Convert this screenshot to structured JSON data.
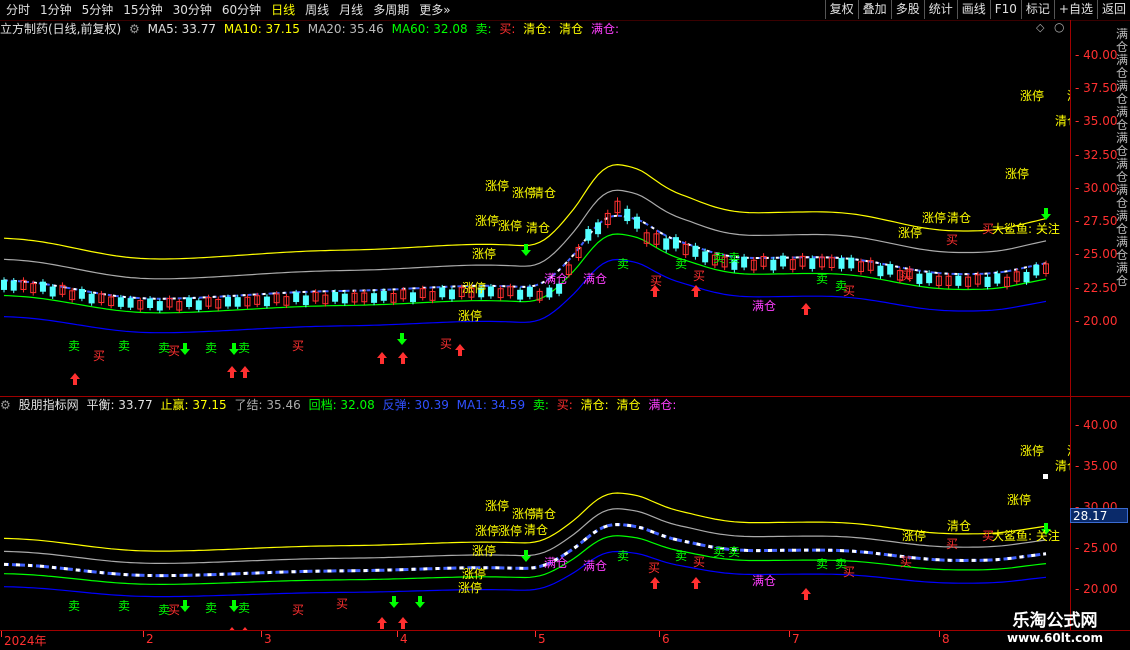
{
  "toolbar": {
    "periods": [
      "分时",
      "1分钟",
      "5分钟",
      "15分钟",
      "30分钟",
      "60分钟",
      "日线",
      "周线",
      "月线",
      "多周期",
      "更多»"
    ],
    "active_period": "日线",
    "right_buttons": [
      "复权",
      "叠加",
      "多股",
      "统计",
      "画线",
      "F10",
      "标记",
      "+自选",
      "返回"
    ]
  },
  "top_panel": {
    "title": "立方制药(日线,前复权)",
    "ma5": "MA5: 33.77",
    "ma10": "MA10: 37.15",
    "ma20": "MA20: 35.46",
    "ma60": "MA60: 32.08",
    "sell_label": "卖:",
    "buy_label": "买:",
    "clear_label": "清仓:",
    "clear2_label": "清仓",
    "full_label": "满仓:",
    "axis_ticks": [
      "40.00",
      "37.50",
      "35.00",
      "32.50",
      "30.00",
      "27.50",
      "25.00",
      "22.50",
      "20.00"
    ],
    "annotation_big_fish": "大鲨鱼: 关注",
    "side_text": "满仓满仓满仓满仓满仓满仓满仓满仓满仓满仓"
  },
  "bottom_panel": {
    "title": "股朋指标网",
    "balance": "平衡: 33.77",
    "take_profit": "止赢: 37.15",
    "close_out": "了结: 35.46",
    "pullback": "回档: 32.08",
    "rebound": "反弹: 30.39",
    "ma1": "MA1: 34.59",
    "sell_label": "卖:",
    "buy_label": "买:",
    "clear_label": "清仓:",
    "clear2_label": "清仓",
    "full_label": "满仓:",
    "axis_ticks": [
      "40.00",
      "35.00",
      "30.00",
      "25.00",
      "20.00"
    ],
    "current_value": "28.17",
    "annotation_big_fish": "大鲨鱼: 关注"
  },
  "time_axis": [
    "2024年",
    "2",
    "3",
    "4",
    "5",
    "6",
    "7",
    "8"
  ],
  "labels": {
    "zhang_ting": "涨停",
    "qing_cang": "清仓",
    "man_cang": "满仓",
    "mai": "卖",
    "mai_buy": "买"
  },
  "watermark": {
    "line1": "乐淘公式网",
    "line2": "www.60lt.com"
  },
  "colors": {
    "up": "#ff3030",
    "down": "#54ffff",
    "yellow": "#ffff00",
    "magenta": "#ff40ff",
    "green": "#00ff00",
    "blue": "#0000ff",
    "white": "#ffffff"
  }
}
